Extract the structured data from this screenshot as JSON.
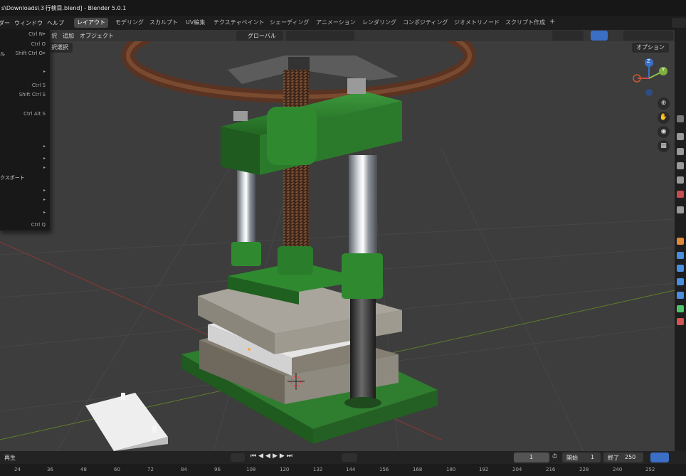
{
  "window": {
    "title": "s\\Downloads\\３行検目.blend] - Blender 5.0.1"
  },
  "menubar": {
    "items": [
      "ダー",
      "ウィンドウ",
      "ヘルプ"
    ],
    "workspaces": [
      "レイアウト",
      "モデリング",
      "スカルプト",
      "UV編集",
      "テクスチャペイント",
      "シェーディング",
      "アニメーション",
      "レンダリング",
      "コンポジティング",
      "ジオメトリノード",
      "スクリプト作成"
    ],
    "active_workspace": "レイアウト",
    "add_tab": "+"
  },
  "viewport_header": {
    "menus": [
      "択",
      "追加",
      "オブジェクト"
    ],
    "transform_orientation": "グローバル",
    "options": "オプション",
    "select_mode": "択選択"
  },
  "file_menu": {
    "rows": [
      {
        "label": "",
        "shortcut": "Ctrl N",
        "submenu": true
      },
      {
        "label": "",
        "shortcut": "Ctrl O",
        "submenu": false
      },
      {
        "label": "ル",
        "shortcut": "Shift Ctrl O",
        "submenu": true
      },
      {
        "label": "",
        "shortcut": "",
        "submenu": true
      },
      {
        "label": "",
        "shortcut": "Ctrl S",
        "submenu": false
      },
      {
        "label": "",
        "shortcut": "Shift Ctrl S",
        "submenu": false
      },
      {
        "label": "",
        "shortcut": "Ctrl Alt S",
        "submenu": false
      },
      {
        "label": "",
        "shortcut": "",
        "submenu": true
      },
      {
        "label": "",
        "shortcut": "",
        "submenu": true
      },
      {
        "label": "クスポート",
        "shortcut": "",
        "submenu": false
      },
      {
        "label": "",
        "shortcut": "",
        "submenu": true
      },
      {
        "label": "",
        "shortcut": "",
        "submenu": true
      },
      {
        "label": "",
        "shortcut": "",
        "submenu": true
      },
      {
        "label": "",
        "shortcut": "Ctrl Q",
        "submenu": false
      }
    ]
  },
  "gizmo": {
    "z_label": "Z",
    "y_label": "Y"
  },
  "timeline": {
    "playback": "再生",
    "current_frame": "1",
    "start_label": "開始",
    "start": "1",
    "end_label": "終了",
    "end": "250"
  },
  "ruler": [
    "24",
    "36",
    "48",
    "60",
    "72",
    "84",
    "96",
    "108",
    "120",
    "132",
    "144",
    "156",
    "168",
    "180",
    "192",
    "204",
    "216",
    "228",
    "240",
    "252"
  ],
  "colors": {
    "green_part": "#2f7d2f",
    "steel_base": "#8e8a80",
    "white_block": "#e6e6e6",
    "accent_blue": "#3b6fc6"
  }
}
